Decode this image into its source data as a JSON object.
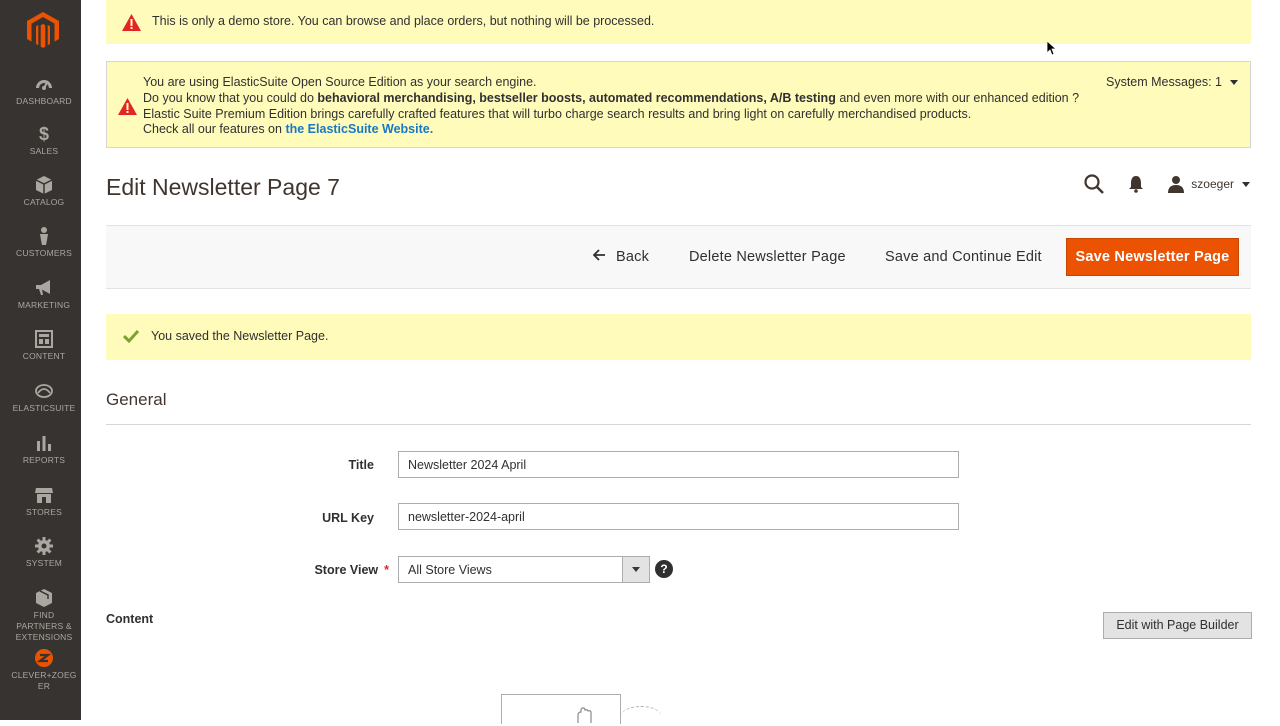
{
  "sidebar": {
    "items": [
      {
        "label": "DASHBOARD",
        "icon": "dashboard-icon"
      },
      {
        "label": "SALES",
        "icon": "dollar-icon"
      },
      {
        "label": "CATALOG",
        "icon": "cube-icon"
      },
      {
        "label": "CUSTOMERS",
        "icon": "person-icon"
      },
      {
        "label": "MARKETING",
        "icon": "megaphone-icon"
      },
      {
        "label": "CONTENT",
        "icon": "layout-icon"
      },
      {
        "label": "ELASTICSUITE",
        "icon": "elasticsuite-icon"
      },
      {
        "label": "REPORTS",
        "icon": "bar-chart-icon"
      },
      {
        "label": "STORES",
        "icon": "store-icon"
      },
      {
        "label": "SYSTEM",
        "icon": "gear-icon"
      },
      {
        "label": "FIND PARTNERS & EXTENSIONS",
        "icon": "box-icon"
      },
      {
        "label": "CLEVER+ZOEGER",
        "icon": "clever-zoeger-icon"
      }
    ]
  },
  "demo_notice": "This is only a demo store. You can browse and place orders, but nothing will be processed.",
  "system_message": {
    "line1": "You are using ElasticSuite Open Source Edition as your search engine.",
    "line2_prefix": "Do you know that you could do ",
    "line2_bold": "behavioral merchandising, bestseller boosts, automated recommendations, A/B testing",
    "line2_suffix": " and even more with our enhanced edition ?",
    "line3": "Elastic Suite Premium Edition brings carefully crafted features that will turbo charge search results and bring light on carefully merchandised products.",
    "line4_prefix": "Check all our features on ",
    "line4_link": "the ElasticSuite Website.",
    "toggle_label": "System Messages: 1"
  },
  "page_title": "Edit Newsletter Page 7",
  "header": {
    "username": "szoeger"
  },
  "actions": {
    "back": "Back",
    "delete": "Delete Newsletter Page",
    "save_continue": "Save and Continue Edit",
    "save": "Save Newsletter Page"
  },
  "success_message": "You saved the Newsletter Page.",
  "section": {
    "title": "General"
  },
  "form": {
    "title_label": "Title",
    "title_value": "Newsletter 2024 April",
    "url_key_label": "URL Key",
    "url_key_value": "newsletter-2024-april",
    "store_view_label": "Store View",
    "store_view_required": "*",
    "store_view_value": "All Store Views",
    "help": "?"
  },
  "content": {
    "label": "Content",
    "page_builder_button": "Edit with Page Builder"
  },
  "colors": {
    "sidebar_bg": "#373330",
    "notice_bg": "#fffbbb",
    "primary": "#eb5202",
    "link": "#1979c3",
    "logo": "#eb5202"
  }
}
